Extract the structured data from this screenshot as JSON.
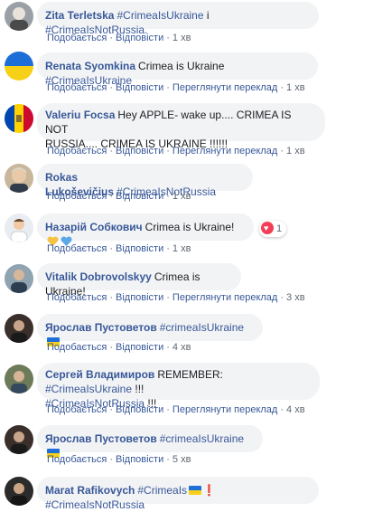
{
  "actions": {
    "like": "Подобається",
    "reply": "Відповісти",
    "see_translation": "Переглянути переклад",
    "sep": "·"
  },
  "comments": [
    {
      "author": "Zita Terletska",
      "parts": [
        "#CrimeaIsUkraine",
        " і ",
        "#CrimeaIsNotRussia."
      ],
      "time": "1 хв"
    },
    {
      "author": "Renata Syomkina",
      "parts": [
        "Crimea is Ukraine ",
        "#CrimeaIsUkraine"
      ],
      "time": "1 хв"
    },
    {
      "author": "Valeriu Focsa",
      "line1": "Hey APPLE- wake up.... CRIMEA IS NOT",
      "line2": "RUSSIA.... CRIMEA IS UKRAINE !!!!!!",
      "time": "1 хв"
    },
    {
      "author": "Rokas Lukoševičius",
      "parts": [
        "#CrimeaIsNotRussia"
      ],
      "time": "1 хв"
    },
    {
      "author": "Назарій Собкович",
      "text": "Crimea is Ukraine!",
      "reaction_count": "1",
      "time": "1 хв"
    },
    {
      "author": "Vitalik Dobrovolskyy",
      "text": "Crimea is Ukraine!",
      "time": "3 хв"
    },
    {
      "author": "Ярослав Пустоветов",
      "tag": "#crimeaIsUkraine",
      "time": "4 хв"
    },
    {
      "author": "Сергей Владимиров",
      "text": "REMEMBER: ",
      "tag1": "#CrimeaIsUkraine",
      "bang1": " !!!",
      "tag2": "#CrimeaIsNotRussia",
      "bang2": " !!!",
      "time": "4 хв"
    },
    {
      "author": "Ярослав Пустоветов",
      "tag": "#crimeaIsUkraine",
      "time": "5 хв"
    },
    {
      "author": "Marat Rafikovych",
      "tag1": "#CrimeaIs",
      "tag2": "#CrimeaIsNotRussia"
    }
  ],
  "colors": {
    "link": "#385898",
    "bubble": "#f2f3f5",
    "meta": "#606770"
  }
}
